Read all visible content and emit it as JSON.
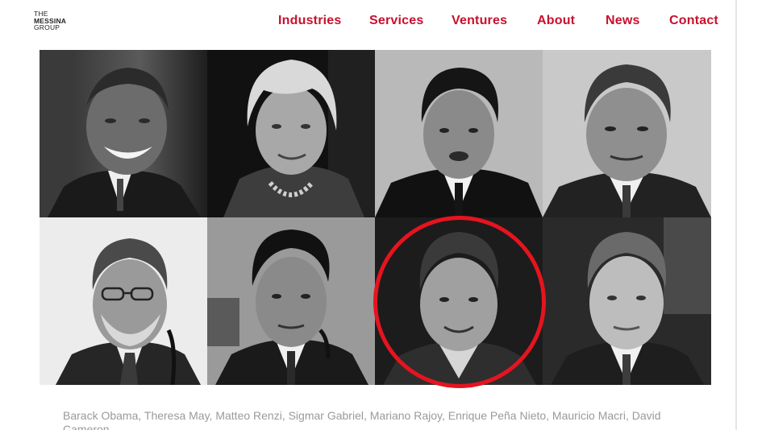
{
  "logo": {
    "line1": "THE",
    "line2": "MESSINA",
    "line3": "GROUP"
  },
  "nav": {
    "items": [
      {
        "label": "Industries"
      },
      {
        "label": "Services"
      },
      {
        "label": "Ventures"
      },
      {
        "label": "About"
      },
      {
        "label": "News"
      },
      {
        "label": "Contact"
      }
    ]
  },
  "colors": {
    "accent": "#c8102e",
    "highlight_ring": "#e5141f",
    "caption_text": "#9a9a9a"
  },
  "portraits": [
    {
      "person": "Barack Obama",
      "background": "dark"
    },
    {
      "person": "Theresa May",
      "background": "dark"
    },
    {
      "person": "Matteo Renzi",
      "background": "light"
    },
    {
      "person": "Sigmar Gabriel",
      "background": "light"
    },
    {
      "person": "Mariano Rajoy",
      "background": "light"
    },
    {
      "person": "Enrique Peña Nieto",
      "background": "gray"
    },
    {
      "person": "Mauricio Macri",
      "background": "dark",
      "highlighted": true
    },
    {
      "person": "David Cameron",
      "background": "dark"
    }
  ],
  "caption": {
    "text": "Barack Obama, Theresa May, Matteo Renzi, Sigmar Gabriel, Mariano Rajoy, Enrique Peña Nieto, Mauricio Macri, David Cameron"
  }
}
